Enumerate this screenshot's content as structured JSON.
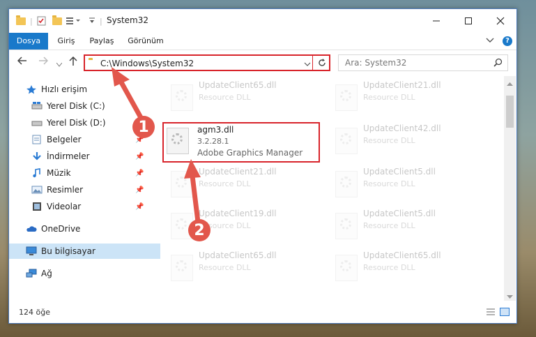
{
  "window": {
    "title": "System32",
    "ribbon_tabs": [
      "Dosya",
      "Giriş",
      "Paylaş",
      "Görünüm"
    ],
    "address": "C:\\Windows\\System32",
    "search_placeholder": "Ara: System32"
  },
  "nav": [
    {
      "label": "Hızlı erişim",
      "icon": "star-icon"
    },
    {
      "label": "Yerel Disk (C:)",
      "icon": "drive-icon"
    },
    {
      "label": "Yerel Disk (D:)",
      "icon": "drive-icon"
    },
    {
      "label": "Belgeler",
      "icon": "documents-icon"
    },
    {
      "label": "İndirmeler",
      "icon": "download-icon"
    },
    {
      "label": "Müzik",
      "icon": "music-icon"
    },
    {
      "label": "Resimler",
      "icon": "pictures-icon"
    },
    {
      "label": "Videolar",
      "icon": "video-icon"
    },
    {
      "label": "OneDrive",
      "icon": "cloud-icon"
    },
    {
      "label": "Bu bilgisayar",
      "icon": "computer-icon"
    },
    {
      "label": "Ağ",
      "icon": "network-icon"
    }
  ],
  "files": [
    {
      "name": "UpdateClient65.dll",
      "desc": "Resource DLL"
    },
    {
      "name": "UpdateClient21.dll",
      "desc": "Resource DLL"
    },
    {
      "name": "agm3.dll",
      "version": "3.2.28.1",
      "desc": "Adobe Graphics Manager"
    },
    {
      "name": "UpdateClient42.dll",
      "desc": "Resource DLL"
    },
    {
      "name": "UpdateClient21.dll",
      "desc": "Resource DLL"
    },
    {
      "name": "UpdateClient5.dll",
      "desc": "Resource DLL"
    },
    {
      "name": "UpdateClient19.dll",
      "desc": "Resource DLL"
    },
    {
      "name": "UpdateClient5.dll",
      "desc": "Resource DLL"
    },
    {
      "name": "UpdateClient65.dll",
      "desc": "Resource DLL"
    },
    {
      "name": "UpdateClient65.dll",
      "desc": "Resource DLL"
    }
  ],
  "status_text": "124 öğe",
  "annotations": [
    "1",
    "2"
  ],
  "colors": {
    "accent": "#1979ca",
    "highlight": "#d8232a",
    "badge": "#e2574c"
  }
}
